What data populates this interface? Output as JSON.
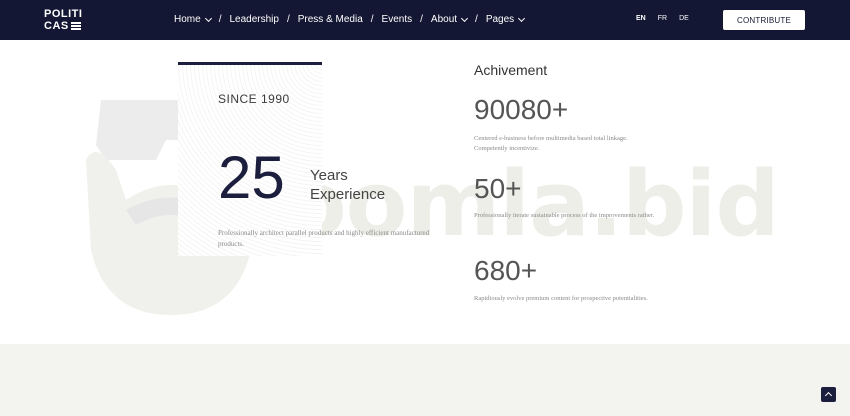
{
  "header": {
    "logo_line1": "POLITI",
    "logo_line2": "CAS",
    "nav": [
      {
        "label": "Home",
        "dropdown": true
      },
      {
        "label": "Leadership",
        "dropdown": false
      },
      {
        "label": "Press & Media",
        "dropdown": false
      },
      {
        "label": "Events",
        "dropdown": false
      },
      {
        "label": "About",
        "dropdown": true
      },
      {
        "label": "Pages",
        "dropdown": true
      }
    ],
    "separator": "/",
    "languages": [
      "EN",
      "FR",
      "DE"
    ],
    "active_language": "EN",
    "contribute_label": "CONTRIBUTE"
  },
  "experience": {
    "since": "SINCE 1990",
    "years": "25",
    "years_label_1": "Years",
    "years_label_2": "Experience",
    "description": "Professionally architect parallel products and highly efficient manufactured products."
  },
  "achievement": {
    "title": "Achivement",
    "stats": [
      {
        "value": "90080+",
        "description": "Centered e-business before multimedia based total linkage. Competently incentivize."
      },
      {
        "value": "50+",
        "description": "Professionally iterate sustainable process of the improvements rather."
      },
      {
        "value": "680+",
        "description": "Rapidiously evolve premium content for prospective potentialities."
      }
    ]
  },
  "watermark": {
    "text": "joomla.bid"
  },
  "colors": {
    "navbar": "#141733",
    "accent": "#1b1e3c",
    "footer": "#f3f3ef"
  },
  "icons": {
    "scroll_top": "chevron-up-icon",
    "dropdown": "chevron-down-icon"
  }
}
